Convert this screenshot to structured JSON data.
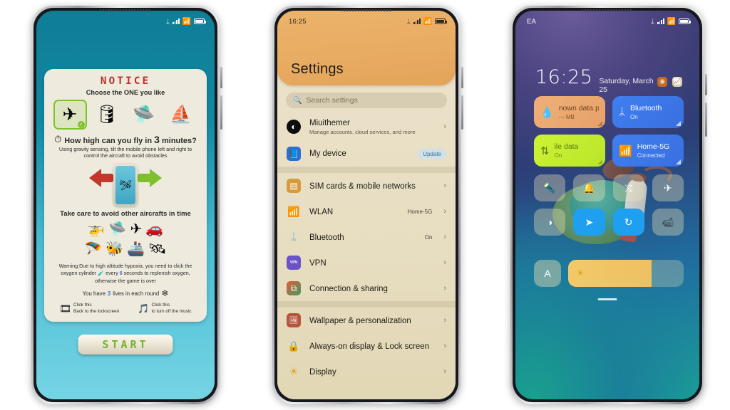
{
  "phone1": {
    "statusbar": {
      "bluetooth": "bluetooth-icon",
      "signal": "signal-icon",
      "wifi": "wifi-icon",
      "battery": "battery-icon"
    },
    "notice": {
      "title": "NOTICE",
      "subtitle": "Choose the ONE you like",
      "crafts": [
        {
          "name": "red-biplane",
          "glyph": "✈",
          "selected": true,
          "check": "✓"
        },
        {
          "name": "barrel-ship",
          "glyph": "🛢",
          "selected": false,
          "check": ""
        },
        {
          "name": "white-blimp",
          "glyph": "🛸",
          "selected": false,
          "check": ""
        },
        {
          "name": "flying-boat",
          "glyph": "⛵",
          "selected": false,
          "check": ""
        }
      ],
      "how_high_prefix": "How high can you fly in ",
      "how_high_number": "3",
      "how_high_suffix": " minutes?",
      "how_icon": "compass-icon",
      "instruction": "Using gravity sensing, tilt the mobile phone left and right to control the aircraft to avoid obstacles",
      "tilt_phone_icon": "phone-tilt-icon",
      "tilt_craft_icon": "🛩",
      "take_care": "Take care to avoid other aircrafts in time",
      "enemies_row1": [
        "🚁",
        "🛸",
        "✈",
        "🚗"
      ],
      "enemies_row2": [
        "🪂",
        "🐝",
        "🚢",
        "🛰"
      ],
      "warning_a": "Warning:Due to high altitude hypoxia, you need to click the oxygen cylinder ",
      "warning_icon": "oxygen-cylinder-icon",
      "warning_b": " every ",
      "warning_seconds": "6",
      "warning_c": " seconds to replenish oxygen, otherwise the game is over",
      "lives_a": "You have ",
      "lives_number": "3",
      "lives_b": " lives in each round",
      "lives_icon": "life-icon",
      "hint1_icon": "lockscreen-icon",
      "hint1_l1": "Click this",
      "hint1_l2": "Back to the  lockscreen",
      "hint2_icon": "music-note-icon",
      "hint2_l1": "Click this",
      "hint2_l2": "to turn off the music"
    },
    "start_button": "START"
  },
  "phone2": {
    "statusbar": {
      "time": "16:25"
    },
    "header_title": "Settings",
    "search_placeholder": "Search settings",
    "search_icon": "search-icon",
    "groups": [
      {
        "items": [
          {
            "icon": "account-avatar-icon",
            "icon_bg": "#0d0d0d",
            "glyph": "◐",
            "title": "Miuithemer",
            "subtitle": "Manage accounts, cloud services, and more",
            "value": "",
            "badge": "",
            "chevron": "›"
          },
          {
            "icon": "my-device-icon",
            "icon_bg": "#2b6fd4",
            "glyph": "📘",
            "title": "My device",
            "subtitle": "",
            "value": "",
            "badge": "Update",
            "chevron": ""
          }
        ]
      },
      {
        "items": [
          {
            "icon": "sim-card-icon",
            "icon_bg": "#d79a3c",
            "glyph": "▤",
            "title": "SIM cards & mobile networks",
            "subtitle": "",
            "value": "",
            "badge": "",
            "chevron": "›"
          },
          {
            "icon": "wlan-icon",
            "icon_bg": "#b8bdbf",
            "glyph": "📶",
            "title": "WLAN",
            "subtitle": "",
            "value": "Home-5G",
            "badge": "",
            "chevron": "›"
          },
          {
            "icon": "bluetooth-icon",
            "icon_bg": "#5aa7e0",
            "glyph": "ᛦ",
            "title": "Bluetooth",
            "subtitle": "",
            "value": "On",
            "badge": "",
            "chevron": "›"
          },
          {
            "icon": "vpn-icon",
            "icon_bg": "#6b52c9",
            "glyph": "VPN",
            "title": "VPN",
            "subtitle": "",
            "value": "",
            "badge": "",
            "chevron": "›"
          },
          {
            "icon": "connection-sharing-icon",
            "icon_bg": "#3f9e5c",
            "glyph": "⧉",
            "title": "Connection & sharing",
            "subtitle": "",
            "value": "",
            "badge": "",
            "chevron": "›"
          }
        ]
      },
      {
        "items": [
          {
            "icon": "wallpaper-icon",
            "icon_bg": "#b5553c",
            "glyph": "🖼",
            "title": "Wallpaper & personalization",
            "subtitle": "",
            "value": "",
            "badge": "",
            "chevron": "›"
          },
          {
            "icon": "lock-screen-icon",
            "icon_bg": "#8d8b86",
            "glyph": "🔒",
            "title": "Always-on display & Lock screen",
            "subtitle": "",
            "value": "",
            "badge": "",
            "chevron": "›"
          },
          {
            "icon": "display-icon",
            "icon_bg": "#e0a81f",
            "glyph": "☀",
            "title": "Display",
            "subtitle": "",
            "value": "",
            "badge": "",
            "chevron": "›"
          }
        ]
      }
    ]
  },
  "phone3": {
    "statusbar": {
      "carrier": "EA"
    },
    "clock": {
      "time": "16:25",
      "date": "Saturday, March 25"
    },
    "app_icons": [
      {
        "name": "camera-shortcut-icon",
        "glyph": "◉",
        "bg": "#c06a28",
        "color": "#f3dcc0"
      },
      {
        "name": "notes-shortcut-icon",
        "glyph": "📈",
        "bg": "#d8d29a",
        "color": "#2c7a35"
      }
    ],
    "big_tiles": [
      {
        "name": "data-plan-tile",
        "style": "tile-orange",
        "icon": "water-drop-icon",
        "glyph": "💧",
        "title": "nown data pla",
        "sub": "--- MB"
      },
      {
        "name": "bluetooth-tile",
        "style": "tile-blue",
        "icon": "bluetooth-icon",
        "glyph": "ᛦ",
        "title": "Bluetooth",
        "sub": "On"
      },
      {
        "name": "mobile-data-tile",
        "style": "tile-green",
        "icon": "data-arrows-icon",
        "glyph": "⇅",
        "title": "ile data",
        "sub": "On"
      },
      {
        "name": "wifi-tile",
        "style": "tile-blue",
        "icon": "wifi-icon",
        "glyph": "📶",
        "title": "Home-5G",
        "sub": "Connected"
      }
    ],
    "grid_tiles": [
      {
        "name": "flashlight-toggle",
        "glyph": "🔦",
        "on": false
      },
      {
        "name": "silent-bell-toggle",
        "glyph": "🔔",
        "on": false
      },
      {
        "name": "cast-toggle",
        "glyph": "⤨",
        "on": false
      },
      {
        "name": "airplane-mode-toggle",
        "glyph": "✈",
        "on": false
      },
      {
        "name": "dark-mode-toggle",
        "glyph": "◑",
        "on": false
      },
      {
        "name": "location-toggle",
        "glyph": "➤",
        "on": true
      },
      {
        "name": "auto-rotate-toggle",
        "glyph": "↻",
        "on": true
      },
      {
        "name": "screen-record-toggle",
        "glyph": "📹",
        "on": false
      }
    ],
    "brightness": {
      "auto_label": "A",
      "sun_icon": "sun-icon",
      "sun_glyph": "☀",
      "level_percent": 72
    },
    "handle": "drag-handle"
  }
}
